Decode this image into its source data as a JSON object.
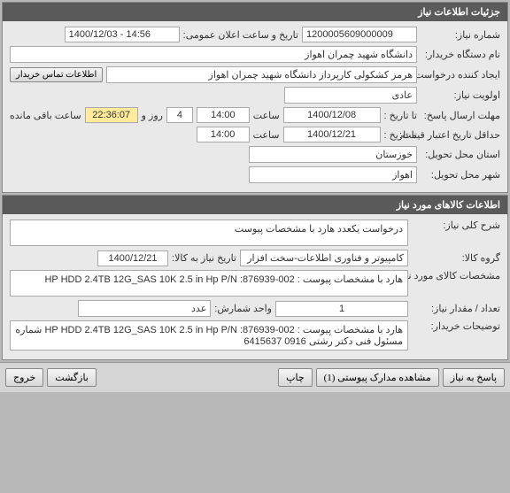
{
  "panel1": {
    "title": "جزئیات اطلاعات نیاز",
    "need_number_label": "شماره نیاز:",
    "need_number": "1200005609000009",
    "public_announce_label": "تاریخ و ساعت اعلان عمومی:",
    "public_announce": "1400/12/03 - 14:56",
    "buyer_label": "نام دستگاه خریدار:",
    "buyer": "دانشگاه شهید چمران اهواز",
    "requester_label": "ایجاد کننده درخواست:",
    "requester": "هرمز کشکولی کارپرداز دانشگاه شهید چمران اهواز",
    "contact_btn": "اطلاعات تماس خریدار",
    "priority_label": "اولویت نیاز:",
    "priority": "عادی",
    "deadline_label": "مهلت ارسال پاسخ:",
    "to_date_label": "تا تاریخ :",
    "deadline_date": "1400/12/08",
    "time_label": "ساعت",
    "deadline_time": "14:00",
    "days_count": "4",
    "days_and": "روز و",
    "countdown": "22:36:07",
    "remaining": "ساعت باقی مانده",
    "validity_label": "حداقل تاریخ اعتبار قیمت:",
    "validity_date": "1400/12/21",
    "validity_time": "14:00",
    "province_label": "استان محل تحویل:",
    "province": "خوزستان",
    "city_label": "شهر محل تحویل:",
    "city": "اهواز"
  },
  "panel2": {
    "title": "اطلاعات کالاهای مورد نیاز",
    "overall_label": "شرح کلی نیاز:",
    "overall": "درخواست یکعدد هارد با مشخصات پیوست",
    "group_label": "گروه کالا:",
    "group": "کامپیوتر و فناوری اطلاعات-سخت افزار",
    "need_date_label": "تاریخ نیاز به کالا:",
    "need_date": "1400/12/21",
    "spec_label": "مشخصات کالای مورد نیاز:",
    "spec": "هارد با مشخصات پیوست :  HP HDD 2.4TB 12G_SAS 10K 2.5 in    Hp P/N :876939-002",
    "qty_label": "تعداد / مقدار نیاز:",
    "qty": "1",
    "unit_label": "واحد شمارش:",
    "unit": "عدد",
    "buyer_notes_label": "توضیحات خریدار:",
    "buyer_notes": "هارد با مشخصات پیوست :  HP HDD 2.4TB 12G_SAS 10K 2.5 in    Hp P/N :876939-002   شماره مسئول فنی دکتر رشتی 0916 6415637"
  },
  "footer": {
    "reply": "پاسخ به نیاز",
    "attachments": "مشاهده مدارک پیوستی (1)",
    "print": "چاپ",
    "back": "بازگشت",
    "exit": "خروج"
  }
}
